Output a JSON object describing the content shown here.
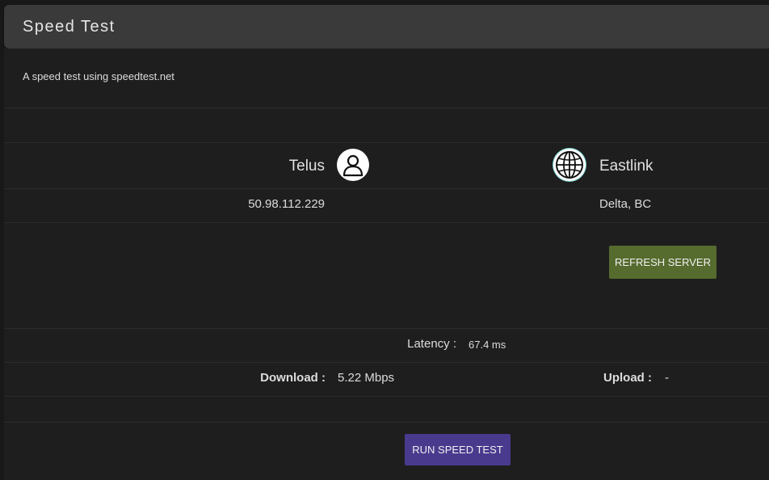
{
  "header": {
    "title": "Speed Test"
  },
  "description": "A speed test using speedtest.net",
  "client": {
    "isp": "Telus",
    "ip": "50.98.112.229",
    "icon": "user-icon"
  },
  "server": {
    "name": "Eastlink",
    "location": "Delta, BC",
    "icon": "globe-icon"
  },
  "buttons": {
    "refresh_label": "REFRESH SERVER",
    "run_label": "RUN SPEED TEST"
  },
  "results": {
    "latency_label": "Latency :",
    "latency_value": "67.4 ms",
    "download_label": "Download :",
    "download_value": "5.22 Mbps",
    "upload_label": "Upload :",
    "upload_value": "-"
  },
  "colors": {
    "refresh_button": "#566b2e",
    "run_button": "#4a3a8e",
    "header_bg": "#3a3a3a",
    "panel_bg": "#1e1e1e"
  }
}
